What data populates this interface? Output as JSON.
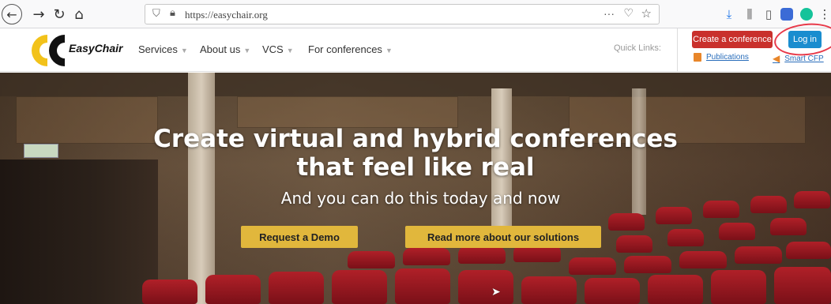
{
  "browser": {
    "url": "https://easychair.org",
    "icons": {
      "back": "back-arrow-icon",
      "forward": "forward-arrow-icon",
      "reload": "reload-icon",
      "home": "home-icon",
      "shield": "tracking-shield-icon",
      "lock": "lock-icon",
      "more": "page-actions-icon",
      "pocket": "pocket-icon",
      "star": "bookmark-star-icon",
      "download": "download-icon",
      "library": "library-icon",
      "sidebar": "sidebar-icon",
      "extension1": "extension-icon",
      "extension2": "grammarly-icon",
      "menu": "menu-icon"
    }
  },
  "header": {
    "logo_text": "EasyChair",
    "nav": [
      {
        "label": "Services"
      },
      {
        "label": "About us"
      },
      {
        "label": "VCS"
      },
      {
        "label": "For conferences"
      }
    ],
    "quick_links_label": "Quick Links:",
    "create_conference_label": "Create a conference",
    "login_label": "Log in",
    "publications_label": "Publications",
    "smart_cfp_label": "Smart CFP"
  },
  "hero": {
    "title_line1": "Create virtual and hybrid conferences",
    "title_line2": "that feel like real",
    "subtitle": "And you can do this today and now",
    "demo_button": "Request a Demo",
    "solutions_button": "Read more about our solutions"
  },
  "colors": {
    "create_button": "#c9302c",
    "login_button": "#1a8dcf",
    "hero_button": "#e1b73c",
    "annotation_circle": "#e83a4a",
    "logo_yellow": "#f2c21a"
  }
}
